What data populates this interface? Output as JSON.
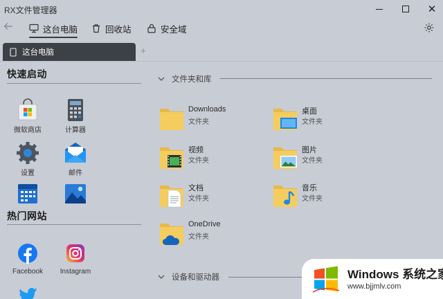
{
  "window": {
    "title": "RX文件管理器"
  },
  "nav": {
    "tabs": [
      {
        "label": "这台电脑"
      },
      {
        "label": "回收站"
      },
      {
        "label": "安全域"
      }
    ]
  },
  "tabstrip": {
    "active_tab": "这台电脑",
    "add": "+"
  },
  "quick": {
    "title": "快速启动",
    "items": [
      {
        "label": "微软商店",
        "icon": "store-icon"
      },
      {
        "label": "计算器",
        "icon": "calculator-icon"
      },
      {
        "label": "设置",
        "icon": "settings-gear-icon"
      },
      {
        "label": "邮件",
        "icon": "mail-icon"
      },
      {
        "label": "",
        "icon": "calendar-icon"
      },
      {
        "label": "",
        "icon": "photos-icon"
      }
    ]
  },
  "hot": {
    "title": "热门网站",
    "items": [
      {
        "label": "Facebook",
        "icon": "facebook-icon"
      },
      {
        "label": "Instagram",
        "icon": "instagram-icon"
      },
      {
        "label": "",
        "icon": "twitter-icon"
      }
    ]
  },
  "libraries": {
    "title": "文件夹和库",
    "items": [
      {
        "name": "Downloads",
        "type": "文件夹",
        "icon": "downloads-folder-icon"
      },
      {
        "name": "桌面",
        "type": "文件夹",
        "icon": "desktop-folder-icon"
      },
      {
        "name": "视频",
        "type": "文件夹",
        "icon": "videos-folder-icon"
      },
      {
        "name": "图片",
        "type": "文件夹",
        "icon": "pictures-folder-icon"
      },
      {
        "name": "文档",
        "type": "文件夹",
        "icon": "documents-folder-icon"
      },
      {
        "name": "音乐",
        "type": "文件夹",
        "icon": "music-folder-icon"
      },
      {
        "name": "OneDrive",
        "type": "文件夹",
        "icon": "onedrive-folder-icon"
      }
    ]
  },
  "drives": {
    "title": "设备和驱动器"
  },
  "watermark": {
    "line1": "Windows 系统之家",
    "line2": "www.bjjmlv.com"
  },
  "colors": {
    "folder": "#f5cd5e",
    "accent": "#1e88e5",
    "tab_bg": "#3d4046"
  }
}
